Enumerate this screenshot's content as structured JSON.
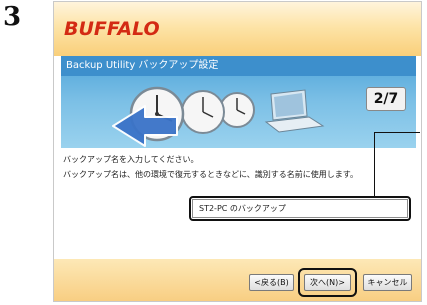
{
  "step_number": "3",
  "window": {
    "logo": "BUFFALO",
    "title": "Backup Utility バックアップ設定",
    "step_indicator": "2/7"
  },
  "content": {
    "instruction": "バックアップ名を入力してください。",
    "description": "バックアップ名は、他の環境で復元するときなどに、識別する名前に使用します。",
    "backup_name_value": "ST2-PC のバックアップ"
  },
  "buttons": {
    "back": "<戻る(B)",
    "next": "次へ(N)>",
    "cancel": "キャンセル"
  },
  "colors": {
    "logo": "#d32a13",
    "header_bar": "#3d8fcc",
    "accent_orange": "#f9cf7a"
  },
  "icons": [
    "clock-icon",
    "clock-icon",
    "clock-icon",
    "laptop-icon",
    "back-arrow-icon"
  ]
}
